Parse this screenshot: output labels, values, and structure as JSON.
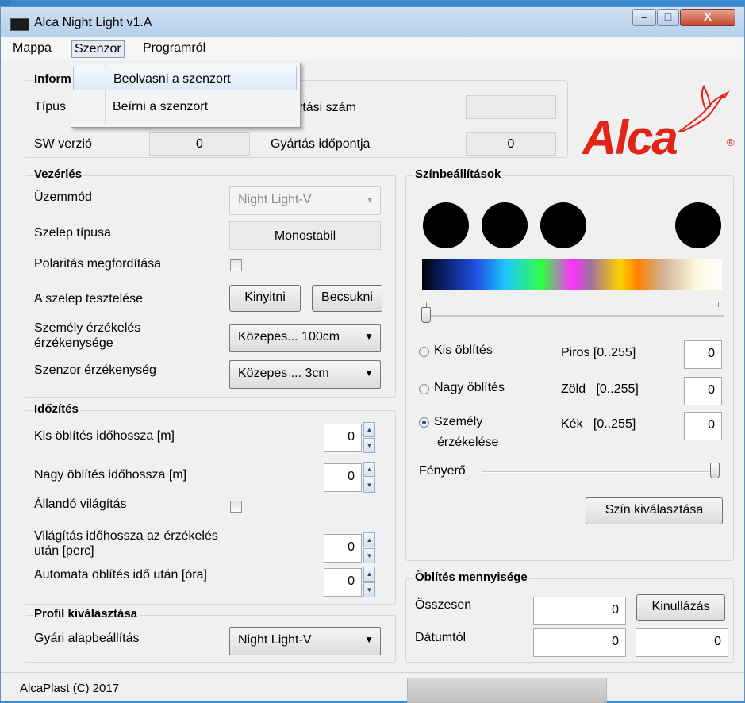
{
  "window": {
    "title": "Alca Night Light  v1.A",
    "min_glyph": "–",
    "max_glyph": "□",
    "close_glyph": "X"
  },
  "menu": {
    "items": [
      "Mappa",
      "Szenzor",
      "Programról"
    ]
  },
  "dropdown": {
    "items": [
      "Beolvasni a szenzort",
      "Beírni a szenzort"
    ]
  },
  "info": {
    "title": "Inform",
    "tipus_label": "Típus",
    "serial_label": "rtási szám",
    "serial_value": "",
    "sw_label": "SW verzió",
    "sw_value": "0",
    "date_label": "Gyártás időpontja",
    "date_value": "0"
  },
  "logo": {
    "text": "Alca",
    "reg": "®"
  },
  "control": {
    "title": "Vezérlés",
    "mode_label": "Üzemmód",
    "mode_value": "Night Light-V",
    "valve_type_label": "Szelep típusa",
    "valve_type_value": "Monostabil",
    "polarity_label": "Polaritás megfordítása",
    "polarity_checked": false,
    "valve_test_label": "A szelep tesztelése",
    "open_button": "Kinyitni",
    "close_button": "Becsukni",
    "person_sens_label_1": "Személy érzékelés",
    "person_sens_label_2": "érzékenysége",
    "person_sens_value": "Közepes... 100cm",
    "sensor_sens_label": "Szenzor érzékenység",
    "sensor_sens_value": "Közepes ... 3cm"
  },
  "timing": {
    "title": "Időzítés",
    "small_flush_label": "Kis öblítés időhossza [m]",
    "small_flush_value": "0",
    "big_flush_label": "Nagy öblítés időhossza [m]",
    "big_flush_value": "0",
    "constant_light_label": "Állandó világítás",
    "constant_light_checked": false,
    "light_after_label_1": "Világítás időhossza az érzékelés",
    "light_after_label_2": "után [perc]",
    "light_after_value": "0",
    "auto_flush_label": "Automata öblítés idő után [óra]",
    "auto_flush_value": "0"
  },
  "profile": {
    "title": "Profil kiválasztása",
    "label": "Gyári alapbeállítás",
    "value": "Night Light-V"
  },
  "colors": {
    "title": "Színbeállítások",
    "swatches": [
      "#000000",
      "#000000",
      "#000000",
      "#000000"
    ],
    "hue_slider": 0,
    "radio_small": "Kis öblítés",
    "radio_big": "Nagy öblítés",
    "radio_person_1": "Személy",
    "radio_person_2": "érzékelése",
    "selected": "person",
    "red_label": "Piros [0..255]",
    "red_value": "0",
    "green_label": "Zöld   [0..255]",
    "green_value": "0",
    "blue_label": "Kék   [0..255]",
    "blue_value": "0",
    "brightness_label": "Fényerő",
    "brightness_level": 1.0,
    "choose_button": "Szín kiválasztása"
  },
  "flush": {
    "title": "Öblítés mennyisége",
    "total_label": "Összesen",
    "total_value": "0",
    "reset_button": "Kinullázás",
    "since_label": "Dátumtól",
    "since_value_1": "0",
    "since_value_2": "0"
  },
  "status": {
    "text": "AlcaPlast  (C) 2017"
  },
  "accent": {
    "brand_red": "#e2231a",
    "selection_blue": "#dfeaf7"
  }
}
